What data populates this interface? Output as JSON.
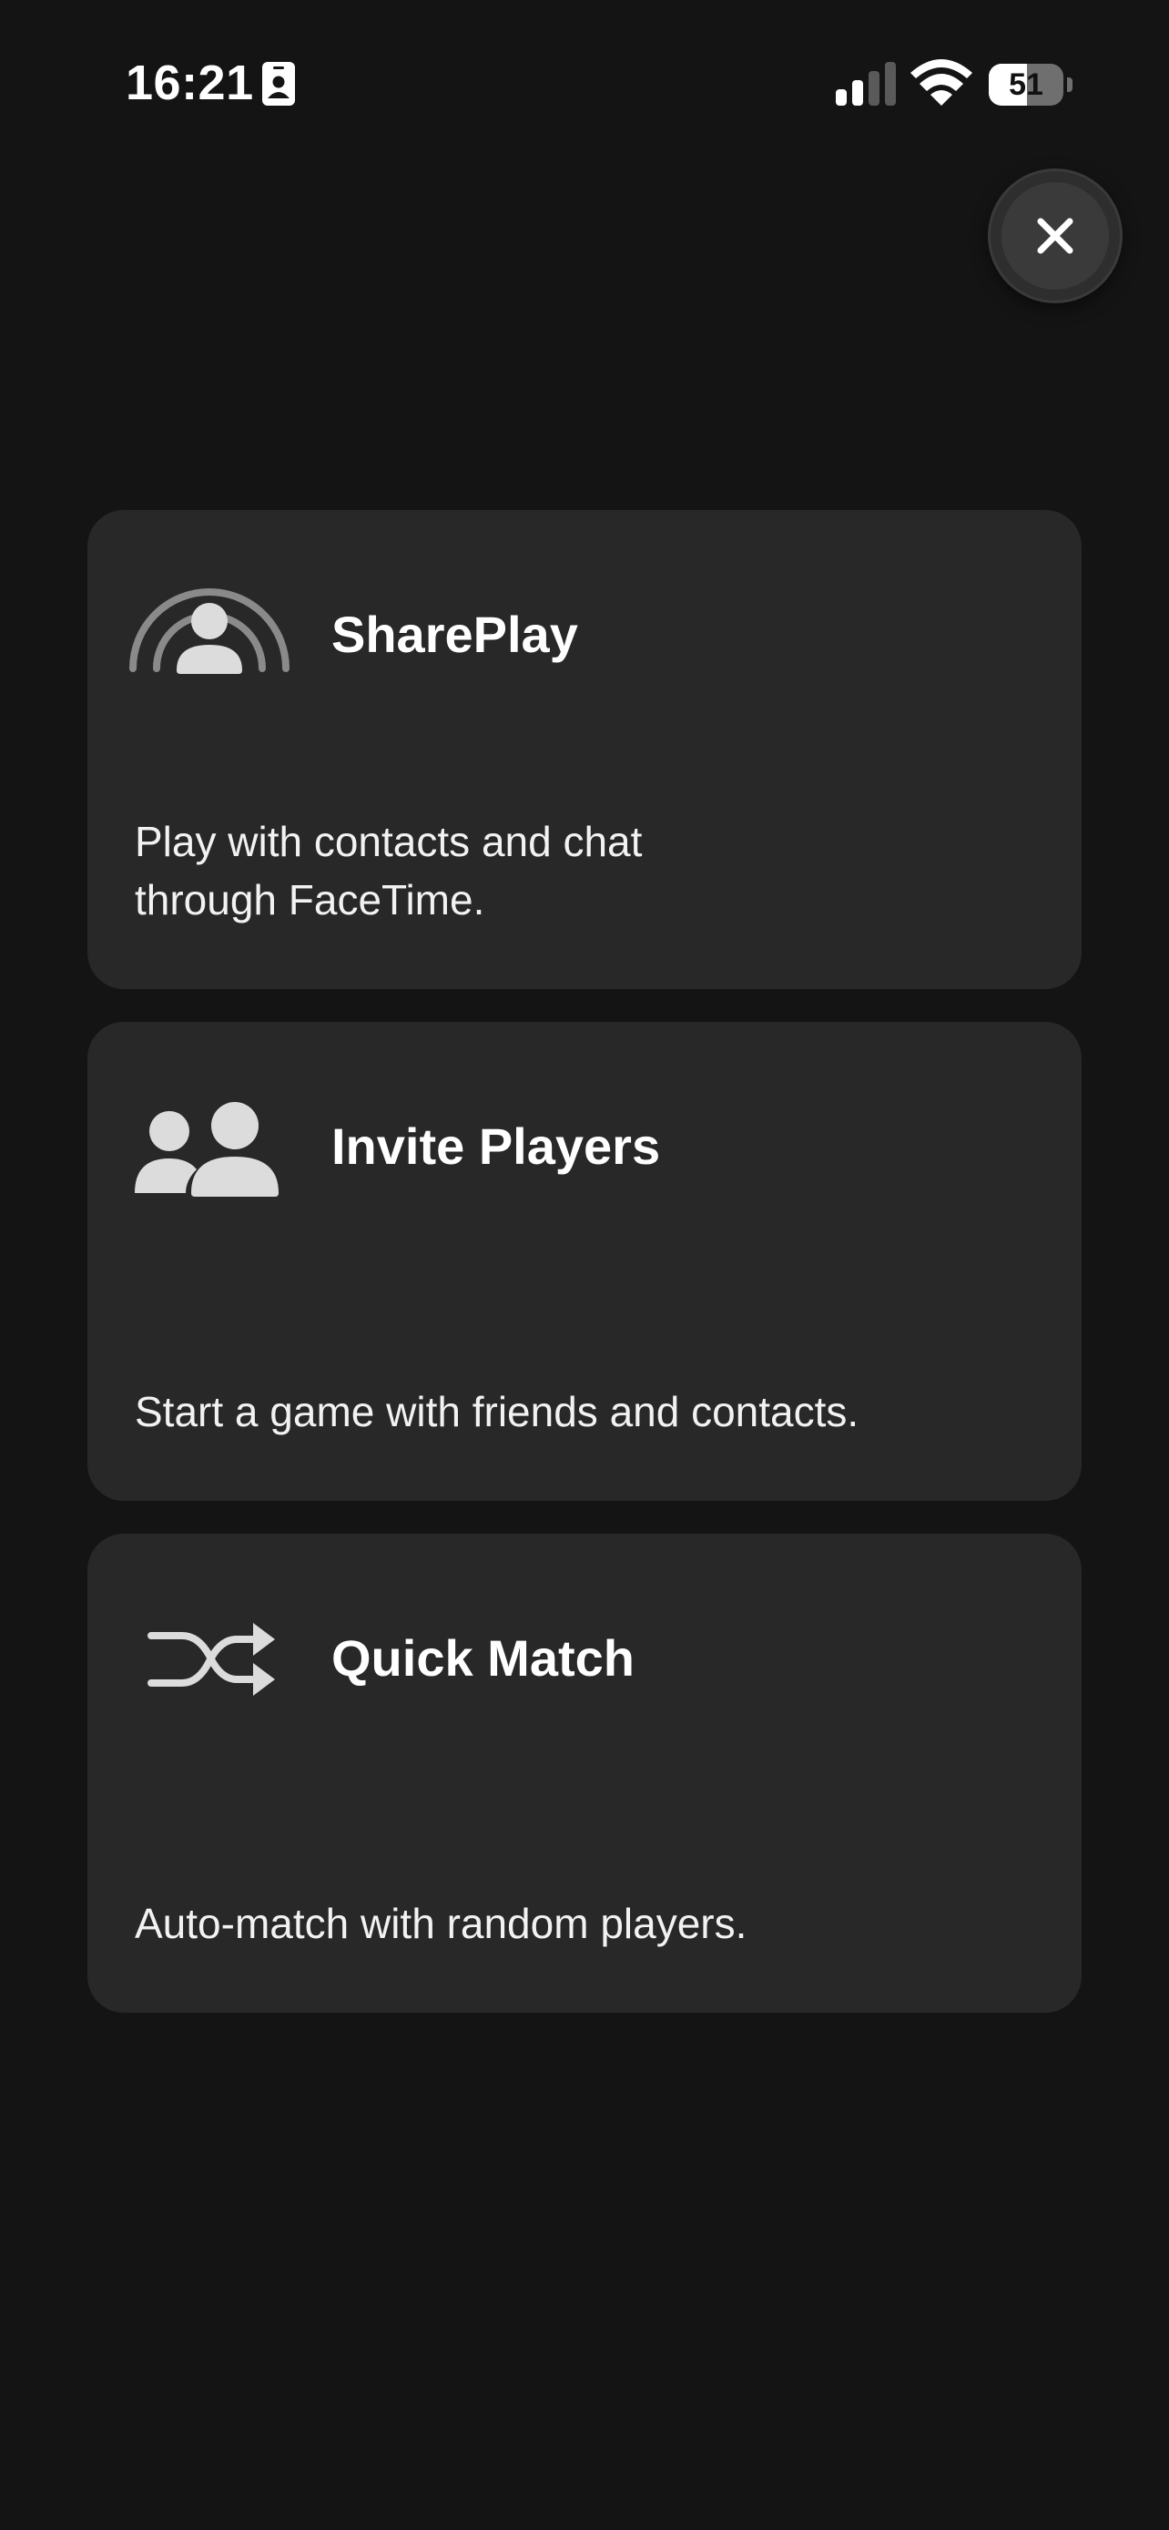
{
  "status_bar": {
    "time": "16:21",
    "battery_level": "51",
    "icons": [
      "contact-card-icon",
      "cellular-signal-icon",
      "wifi-icon",
      "battery-icon"
    ]
  },
  "close_button": {
    "icon": "close-icon"
  },
  "options": [
    {
      "icon": "shareplay-icon",
      "title": "SharePlay",
      "description": "Play with contacts and chat through FaceTime."
    },
    {
      "icon": "two-people-icon",
      "title": "Invite Players",
      "description": "Start a game with friends and contacts."
    },
    {
      "icon": "shuffle-icon",
      "title": "Quick Match",
      "description": "Auto-match with random players."
    }
  ],
  "colors": {
    "background": "#141414",
    "card": "#282828",
    "icon_gray": "#dcdcdc",
    "icon_dim": "#8a8a8a"
  }
}
